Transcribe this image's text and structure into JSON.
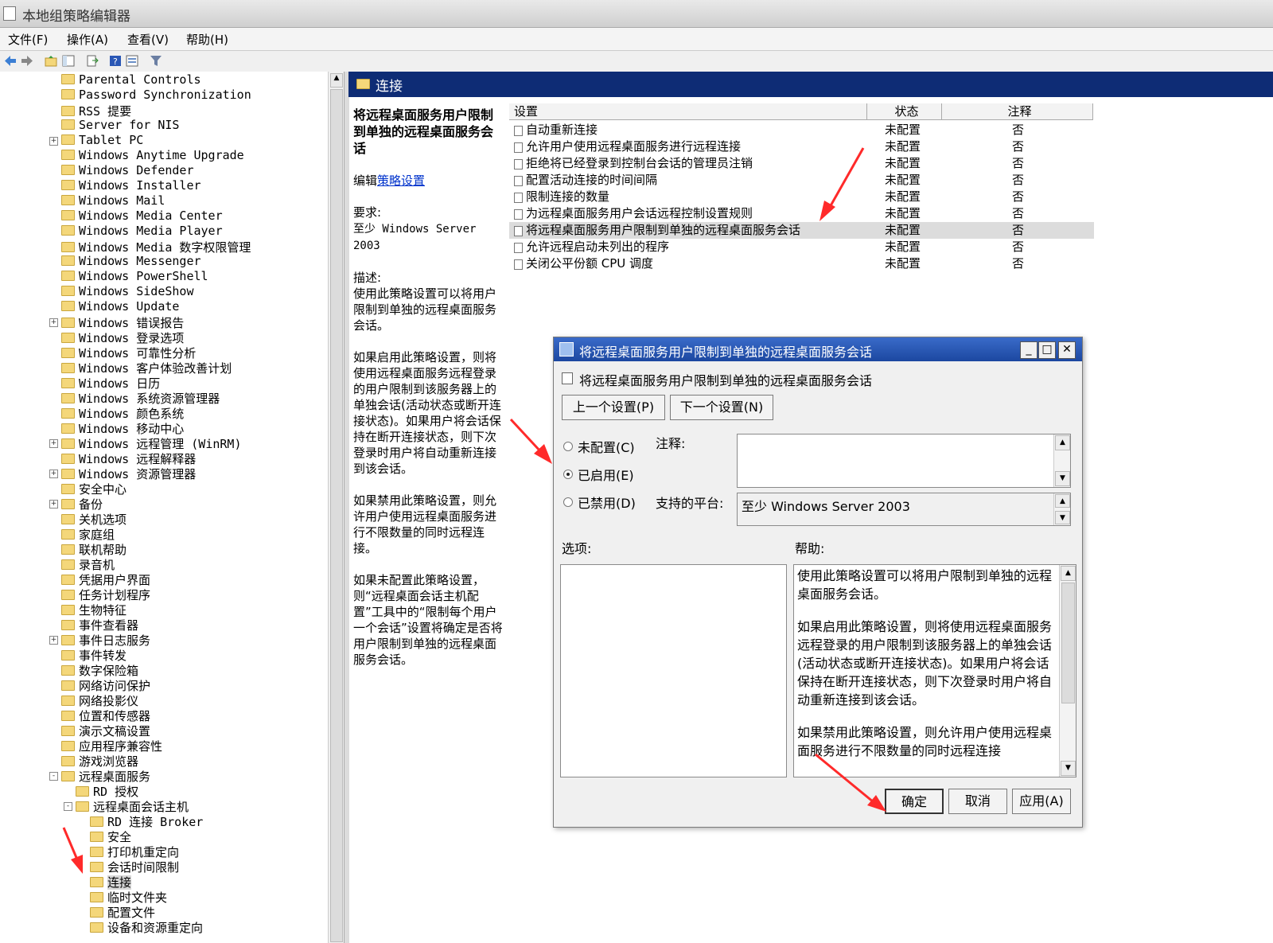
{
  "window": {
    "title": "本地组策略编辑器"
  },
  "menu": [
    "文件(F)",
    "操作(A)",
    "查看(V)",
    "帮助(H)"
  ],
  "tree": {
    "items": [
      {
        "label": "Parental Controls",
        "level": 0,
        "expand": ""
      },
      {
        "label": "Password Synchronization",
        "level": 0,
        "expand": ""
      },
      {
        "label": "RSS 提要",
        "level": 0,
        "expand": ""
      },
      {
        "label": "Server for NIS",
        "level": 0,
        "expand": ""
      },
      {
        "label": "Tablet PC",
        "level": 0,
        "expand": "+"
      },
      {
        "label": "Windows Anytime Upgrade",
        "level": 0,
        "expand": ""
      },
      {
        "label": "Windows Defender",
        "level": 0,
        "expand": ""
      },
      {
        "label": "Windows Installer",
        "level": 0,
        "expand": ""
      },
      {
        "label": "Windows Mail",
        "level": 0,
        "expand": ""
      },
      {
        "label": "Windows Media Center",
        "level": 0,
        "expand": ""
      },
      {
        "label": "Windows Media Player",
        "level": 0,
        "expand": ""
      },
      {
        "label": "Windows Media 数字权限管理",
        "level": 0,
        "expand": ""
      },
      {
        "label": "Windows Messenger",
        "level": 0,
        "expand": ""
      },
      {
        "label": "Windows PowerShell",
        "level": 0,
        "expand": ""
      },
      {
        "label": "Windows SideShow",
        "level": 0,
        "expand": ""
      },
      {
        "label": "Windows Update",
        "level": 0,
        "expand": ""
      },
      {
        "label": "Windows 错误报告",
        "level": 0,
        "expand": "+"
      },
      {
        "label": "Windows 登录选项",
        "level": 0,
        "expand": ""
      },
      {
        "label": "Windows 可靠性分析",
        "level": 0,
        "expand": ""
      },
      {
        "label": "Windows 客户体验改善计划",
        "level": 0,
        "expand": ""
      },
      {
        "label": "Windows 日历",
        "level": 0,
        "expand": ""
      },
      {
        "label": "Windows 系统资源管理器",
        "level": 0,
        "expand": ""
      },
      {
        "label": "Windows 颜色系统",
        "level": 0,
        "expand": ""
      },
      {
        "label": "Windows 移动中心",
        "level": 0,
        "expand": ""
      },
      {
        "label": "Windows 远程管理 (WinRM)",
        "level": 0,
        "expand": "+"
      },
      {
        "label": "Windows 远程解释器",
        "level": 0,
        "expand": ""
      },
      {
        "label": "Windows 资源管理器",
        "level": 0,
        "expand": "+"
      },
      {
        "label": "安全中心",
        "level": 0,
        "expand": ""
      },
      {
        "label": "备份",
        "level": 0,
        "expand": "+"
      },
      {
        "label": "关机选项",
        "level": 0,
        "expand": ""
      },
      {
        "label": "家庭组",
        "level": 0,
        "expand": ""
      },
      {
        "label": "联机帮助",
        "level": 0,
        "expand": ""
      },
      {
        "label": "录音机",
        "level": 0,
        "expand": ""
      },
      {
        "label": "凭据用户界面",
        "level": 0,
        "expand": ""
      },
      {
        "label": "任务计划程序",
        "level": 0,
        "expand": ""
      },
      {
        "label": "生物特征",
        "level": 0,
        "expand": ""
      },
      {
        "label": "事件查看器",
        "level": 0,
        "expand": ""
      },
      {
        "label": "事件日志服务",
        "level": 0,
        "expand": "+"
      },
      {
        "label": "事件转发",
        "level": 0,
        "expand": ""
      },
      {
        "label": "数字保险箱",
        "level": 0,
        "expand": ""
      },
      {
        "label": "网络访问保护",
        "level": 0,
        "expand": ""
      },
      {
        "label": "网络投影仪",
        "level": 0,
        "expand": ""
      },
      {
        "label": "位置和传感器",
        "level": 0,
        "expand": ""
      },
      {
        "label": "演示文稿设置",
        "level": 0,
        "expand": ""
      },
      {
        "label": "应用程序兼容性",
        "level": 0,
        "expand": ""
      },
      {
        "label": "游戏浏览器",
        "level": 0,
        "expand": ""
      },
      {
        "label": "远程桌面服务",
        "level": 0,
        "expand": "-"
      },
      {
        "label": "RD 授权",
        "level": 1,
        "expand": ""
      },
      {
        "label": "远程桌面会话主机",
        "level": 1,
        "expand": "-"
      },
      {
        "label": "RD 连接 Broker",
        "level": 2,
        "expand": ""
      },
      {
        "label": "安全",
        "level": 2,
        "expand": ""
      },
      {
        "label": "打印机重定向",
        "level": 2,
        "expand": ""
      },
      {
        "label": "会话时间限制",
        "level": 2,
        "expand": ""
      },
      {
        "label": "连接",
        "level": 2,
        "expand": "",
        "selected": true
      },
      {
        "label": "临时文件夹",
        "level": 2,
        "expand": ""
      },
      {
        "label": "配置文件",
        "level": 2,
        "expand": ""
      },
      {
        "label": "设备和资源重定向",
        "level": 2,
        "expand": ""
      }
    ]
  },
  "header": {
    "title": "连接"
  },
  "description": {
    "title": "将远程桌面服务用户限制到单独的远程桌面服务会话",
    "edit_prefix": "编辑",
    "edit_link": "策略设置",
    "req_label": "要求:",
    "req_value": "至少 Windows Server 2003",
    "desc_label": "描述:",
    "desc_p1": "使用此策略设置可以将用户限制到单独的远程桌面服务会话。",
    "desc_p2": "如果启用此策略设置，则将使用远程桌面服务远程登录的用户限制到该服务器上的单独会话(活动状态或断开连接状态)。如果用户将会话保持在断开连接状态，则下次登录时用户将自动重新连接到该会话。",
    "desc_p3": "如果禁用此策略设置，则允许用户使用远程桌面服务进行不限数量的同时远程连接。",
    "desc_p4": "如果未配置此策略设置，则“远程桌面会话主机配置”工具中的“限制每个用户一个会话”设置将确定是否将用户限制到单独的远程桌面服务会话。"
  },
  "list": {
    "columns": [
      "设置",
      "状态",
      "注释"
    ],
    "rows": [
      {
        "name": "自动重新连接",
        "state": "未配置",
        "comment": "否"
      },
      {
        "name": "允许用户使用远程桌面服务进行远程连接",
        "state": "未配置",
        "comment": "否"
      },
      {
        "name": "拒绝将已经登录到控制台会话的管理员注销",
        "state": "未配置",
        "comment": "否"
      },
      {
        "name": "配置活动连接的时间间隔",
        "state": "未配置",
        "comment": "否"
      },
      {
        "name": "限制连接的数量",
        "state": "未配置",
        "comment": "否"
      },
      {
        "name": "为远程桌面服务用户会话远程控制设置规则",
        "state": "未配置",
        "comment": "否"
      },
      {
        "name": "将远程桌面服务用户限制到单独的远程桌面服务会话",
        "state": "未配置",
        "comment": "否",
        "selected": true
      },
      {
        "name": "允许远程启动未列出的程序",
        "state": "未配置",
        "comment": "否"
      },
      {
        "name": "关闭公平份额 CPU 调度",
        "state": "未配置",
        "comment": "否"
      }
    ]
  },
  "dialog": {
    "title": "将远程桌面服务用户限制到单独的远程桌面服务会话",
    "subtitle": "将远程桌面服务用户限制到单独的远程桌面服务会话",
    "prev_btn": "上一个设置(P)",
    "next_btn": "下一个设置(N)",
    "radio_notconfig": "未配置(C)",
    "radio_enabled": "已启用(E)",
    "radio_disabled": "已禁用(D)",
    "selected_radio": "enabled",
    "comment_label": "注释:",
    "platform_label": "支持的平台:",
    "platform_value": "至少 Windows Server 2003",
    "options_label": "选项:",
    "help_label": "帮助:",
    "help_p1": "使用此策略设置可以将用户限制到单独的远程桌面服务会话。",
    "help_p2": "如果启用此策略设置，则将使用远程桌面服务远程登录的用户限制到该服务器上的单独会话(活动状态或断开连接状态)。如果用户将会话保持在断开连接状态，则下次登录时用户将自动重新连接到该会话。",
    "help_p3": "如果禁用此策略设置，则允许用户使用远程桌面服务进行不限数量的同时远程连接",
    "ok": "确定",
    "cancel": "取消",
    "apply": "应用(A)"
  },
  "colors": {
    "header_bg": "#0e2c75",
    "arrow": "#ff2a2a",
    "caption": "#1c47a0"
  }
}
